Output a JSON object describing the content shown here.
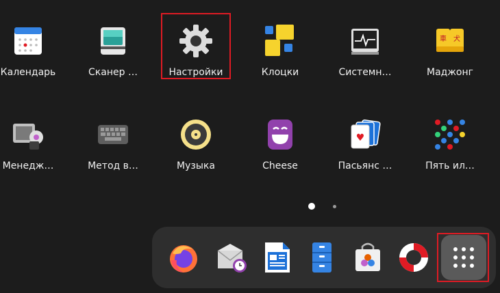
{
  "grid": {
    "apps": [
      {
        "label": "Календарь",
        "icon": "calendar-icon"
      },
      {
        "label": "Сканер …",
        "icon": "scanner-icon"
      },
      {
        "label": "Настройки",
        "icon": "settings-gear-icon"
      },
      {
        "label": "Клоцки",
        "icon": "klotski-icon"
      },
      {
        "label": "Системн…",
        "icon": "system-monitor-icon"
      },
      {
        "label": "Маджонг",
        "icon": "mahjongg-icon"
      },
      {
        "label": "Менедж…",
        "icon": "software-manager-icon"
      },
      {
        "label": "Метод в…",
        "icon": "keyboard-icon"
      },
      {
        "label": "Музыка",
        "icon": "music-speaker-icon"
      },
      {
        "label": "Cheese",
        "icon": "cheese-icon"
      },
      {
        "label": "Пасьянс …",
        "icon": "solitaire-cards-icon"
      },
      {
        "label": "Пять ил…",
        "icon": "five-or-more-icon"
      }
    ]
  },
  "pagination": {
    "pages": 2,
    "current": 1
  },
  "dock": {
    "items": [
      {
        "icon": "firefox-icon"
      },
      {
        "icon": "evolution-mail-icon"
      },
      {
        "icon": "libreoffice-writer-icon"
      },
      {
        "icon": "file-manager-icon"
      },
      {
        "icon": "software-store-icon"
      },
      {
        "icon": "help-lifebuoy-icon"
      }
    ],
    "show_apps_icon": "show-apps-grid-icon"
  },
  "colors": {
    "background": "#1c1c1c",
    "dock": "#2e2e2e",
    "highlight": "#e01b24",
    "show_apps_bg": "#5a5a5a"
  }
}
